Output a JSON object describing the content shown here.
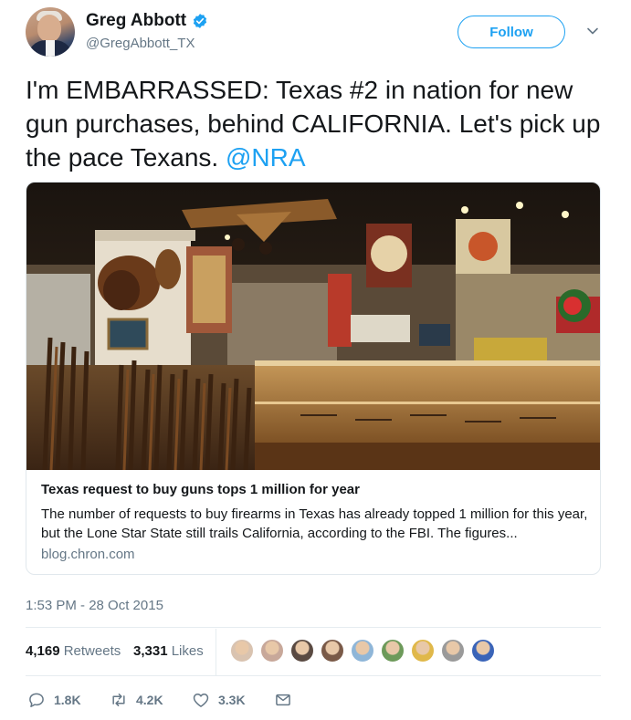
{
  "author": {
    "name": "Greg Abbott",
    "handle": "@GregAbbott_TX",
    "verified": true
  },
  "follow_label": "Follow",
  "tweet": {
    "text": "I'm EMBARRASSED: Texas #2 in nation for new gun purchases, behind CALIFORNIA. Let's pick up the pace Texans. ",
    "mention": "@NRA"
  },
  "card": {
    "title": "Texas request to buy guns tops 1 million for year",
    "description": "The number of requests to buy firearms in Texas has already topped 1 million for this year, but the Lone Star State still trails California, according to the FBI. The figures...",
    "domain": "blog.chron.com"
  },
  "timestamp": "1:53 PM - 28 Oct 2015",
  "stats": {
    "retweets_count": "4,169",
    "retweets_label": "Retweets",
    "likes_count": "3,331",
    "likes_label": "Likes"
  },
  "liker_avatars": [
    "#d9c3b0",
    "#c8a89a",
    "#5a4a42",
    "#7a5a48",
    "#8fb6d8",
    "#6d9a5a",
    "#e0b84a",
    "#9a9a9a",
    "#3a64b8"
  ],
  "actions": {
    "replies": "1.8K",
    "retweets": "4.2K",
    "likes": "3.3K"
  },
  "colors": {
    "accent": "#1da1f2",
    "secondary_text": "#657786",
    "primary_text": "#14171a"
  },
  "icons": [
    "verified-badge-icon",
    "chevron-down-icon",
    "reply-icon",
    "retweet-icon",
    "heart-icon",
    "envelope-icon"
  ]
}
